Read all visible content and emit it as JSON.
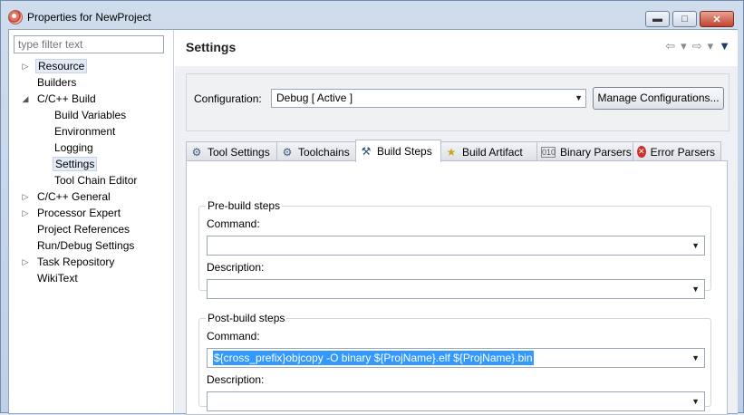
{
  "window": {
    "title": "Properties for NewProject"
  },
  "filter": {
    "placeholder": "type filter text"
  },
  "tree": {
    "items": [
      {
        "label": "Resource",
        "has_arrow": true,
        "expanded": false,
        "indent": 0,
        "selected": false,
        "boxed": true
      },
      {
        "label": "Builders",
        "has_arrow": false,
        "indent": 0
      },
      {
        "label": "C/C++ Build",
        "has_arrow": true,
        "expanded": true,
        "indent": 0
      },
      {
        "label": "Build Variables",
        "has_arrow": false,
        "indent": 1
      },
      {
        "label": "Environment",
        "has_arrow": false,
        "indent": 1
      },
      {
        "label": "Logging",
        "has_arrow": false,
        "indent": 1
      },
      {
        "label": "Settings",
        "has_arrow": false,
        "indent": 1,
        "selected": true
      },
      {
        "label": "Tool Chain Editor",
        "has_arrow": false,
        "indent": 1
      },
      {
        "label": "C/C++ General",
        "has_arrow": true,
        "expanded": false,
        "indent": 0
      },
      {
        "label": "Processor Expert",
        "has_arrow": true,
        "expanded": false,
        "indent": 0
      },
      {
        "label": "Project References",
        "has_arrow": false,
        "indent": 0
      },
      {
        "label": "Run/Debug Settings",
        "has_arrow": false,
        "indent": 0
      },
      {
        "label": "Task Repository",
        "has_arrow": true,
        "expanded": false,
        "indent": 0
      },
      {
        "label": "WikiText",
        "has_arrow": false,
        "indent": 0
      }
    ]
  },
  "settings": {
    "title": "Settings",
    "config_label": "Configuration:",
    "config_value": "Debug  [ Active ]",
    "manage_label": "Manage Configurations..."
  },
  "tabs": [
    {
      "label": "Tool Settings",
      "icon": "tool-settings-icon",
      "active": false
    },
    {
      "label": "Toolchains",
      "icon": "toolchains-icon",
      "active": false
    },
    {
      "label": "Build Steps",
      "icon": "build-steps-icon",
      "active": true
    },
    {
      "label": "Build Artifact",
      "icon": "trophy-icon",
      "active": false
    },
    {
      "label": "Binary Parsers",
      "icon": "binary-icon",
      "active": false
    },
    {
      "label": "Error Parsers",
      "icon": "error-icon",
      "active": false
    }
  ],
  "prebuild": {
    "title": "Pre-build steps",
    "command_label": "Command:",
    "command_value": "",
    "description_label": "Description:",
    "description_value": ""
  },
  "postbuild": {
    "title": "Post-build steps",
    "command_label": "Command:",
    "command_value": "${cross_prefix}objcopy -O binary ${ProjName}.elf ${ProjName}.bin",
    "description_label": "Description:",
    "description_value": ""
  },
  "colors": {
    "selection": "#3399ff",
    "close_button": "#c1432e"
  }
}
